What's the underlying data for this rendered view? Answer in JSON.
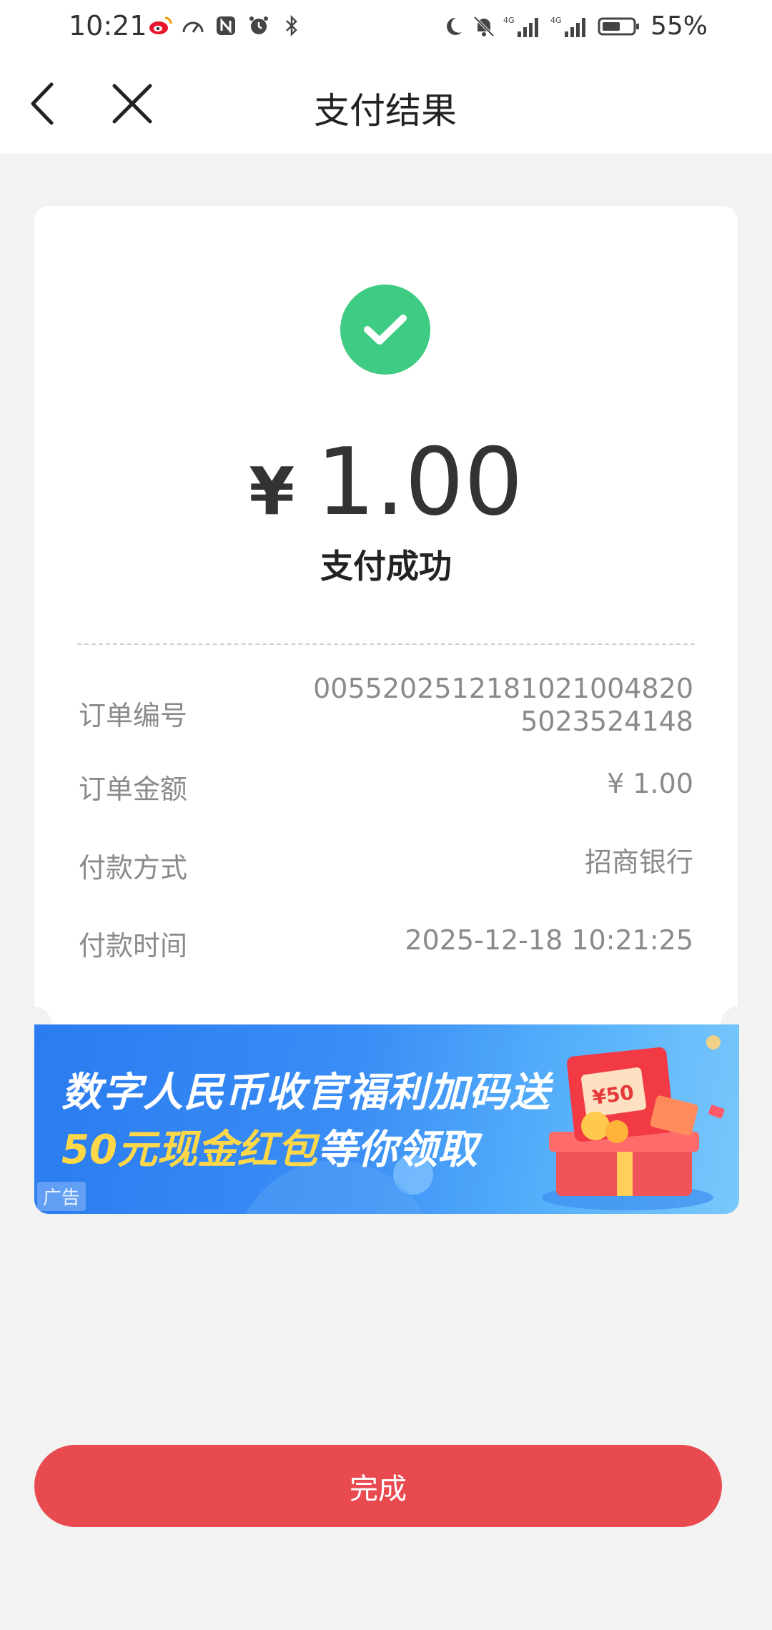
{
  "status_bar": {
    "time": "10:21",
    "battery_percent": "55%",
    "icons_left": [
      "weibo-icon",
      "speed-icon",
      "nfc-icon",
      "alarm-icon",
      "bluetooth-icon"
    ],
    "icons_right": [
      "moon-icon",
      "bell-off-icon",
      "signal-4g-icon",
      "signal-4g-icon",
      "battery-icon"
    ]
  },
  "nav": {
    "title": "支付结果"
  },
  "payment": {
    "currency_symbol": "¥",
    "amount": "1.00",
    "status": "支付成功"
  },
  "details": [
    {
      "label": "订单编号",
      "value_line1": "00552025121810210048​20",
      "value_line2": "5023524148"
    },
    {
      "label": "订单金额",
      "value": "¥ 1.00"
    },
    {
      "label": "付款方式",
      "value": "招商银行"
    },
    {
      "label": "付款时间",
      "value": "2025-12-18 10:21:25"
    }
  ],
  "banner": {
    "line1": "数字人民币收官福利加码送",
    "line2_highlight": "50元现金红包",
    "line2_rest": "等你领取",
    "ad_tag": "广告",
    "coupon_text": "¥50"
  },
  "footer": {
    "done_label": "完成"
  },
  "colors": {
    "success_green": "#3ecb83",
    "primary_red": "#e94a4f",
    "background": "#f2f2f2"
  }
}
